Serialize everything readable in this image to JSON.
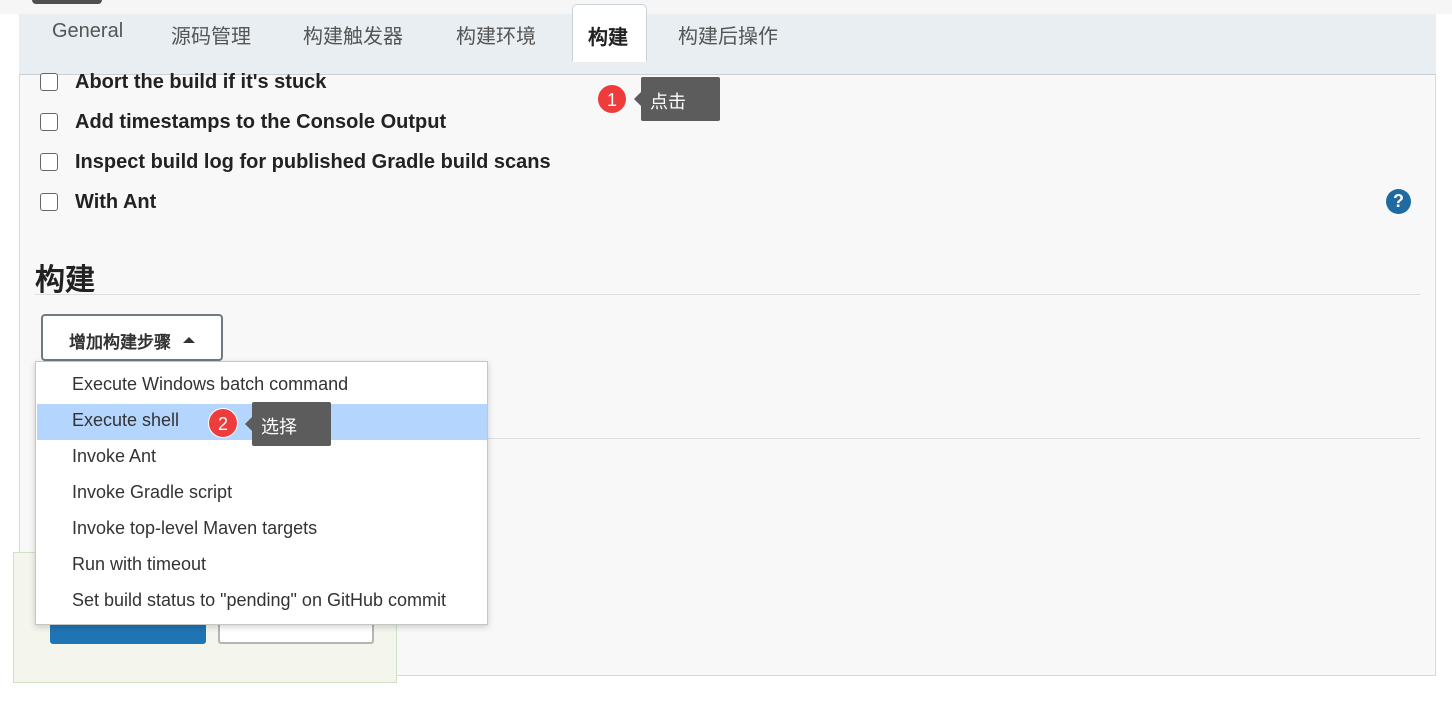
{
  "tabs": [
    {
      "label": "General"
    },
    {
      "label": "源码管理"
    },
    {
      "label": "构建触发器"
    },
    {
      "label": "构建环境"
    },
    {
      "label": "构建"
    },
    {
      "label": "构建后操作"
    }
  ],
  "active_tab": "构建",
  "options": [
    {
      "label": "Abort the build if it's stuck",
      "checked": false
    },
    {
      "label": "Add timestamps to the Console Output",
      "checked": false
    },
    {
      "label": "Inspect build log for published Gradle build scans",
      "checked": false
    },
    {
      "label": "With Ant",
      "checked": false
    }
  ],
  "help_icon": "?",
  "section": {
    "title": "构建"
  },
  "add_step_button": {
    "label": "增加构建步骤"
  },
  "dropdown": {
    "items": [
      {
        "label": "Execute Windows batch command"
      },
      {
        "label": "Execute shell"
      },
      {
        "label": "Invoke Ant"
      },
      {
        "label": "Invoke Gradle script"
      },
      {
        "label": "Invoke top-level Maven targets"
      },
      {
        "label": "Run with timeout"
      },
      {
        "label": "Set build status to \"pending\" on GitHub commit"
      }
    ],
    "highlighted": "Execute shell"
  },
  "annotations": [
    {
      "number": "1",
      "text": "点击"
    },
    {
      "number": "2",
      "text": "选择"
    }
  ],
  "colors": {
    "highlight": "#b4d5fd",
    "badge": "#ee3b3b",
    "tooltip": "#5c5c5c",
    "help": "#1e6aa1",
    "save": "#1f74b3"
  },
  "icons": {
    "checkbox": "checkbox-icon",
    "help": "help-icon",
    "caret": "caret-up-icon"
  }
}
